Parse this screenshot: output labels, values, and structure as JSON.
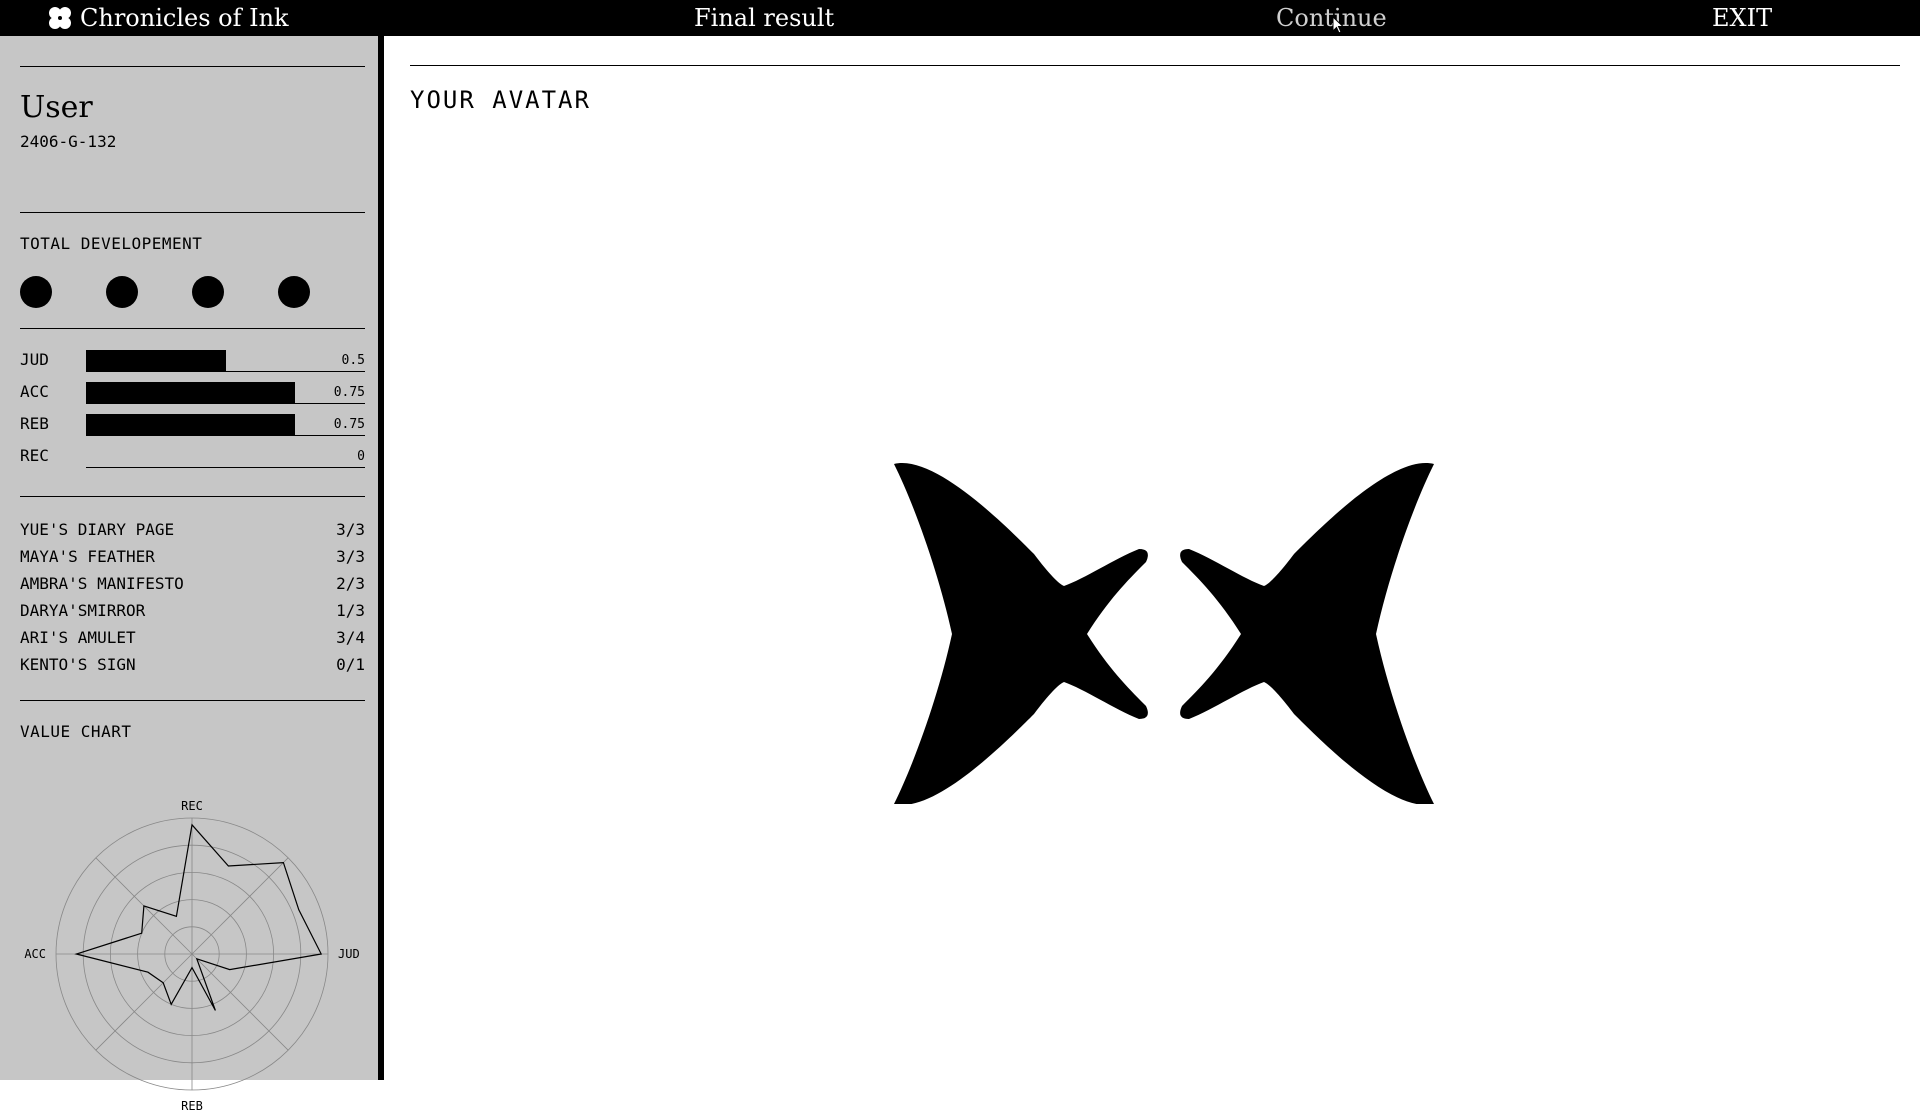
{
  "topbar": {
    "app_title": "Chronicles of Ink",
    "logo_icon": "four-petal-flower-icon",
    "final_result": "Final result",
    "continue": "Continue",
    "exit": "EXIT"
  },
  "user": {
    "name": "User",
    "id": "2406-G-132"
  },
  "development": {
    "title": "TOTAL DEVELOPEMENT",
    "dots_filled": 4
  },
  "stats": [
    {
      "label": "JUD",
      "value": 0.5,
      "display": "0.5"
    },
    {
      "label": "ACC",
      "value": 0.75,
      "display": "0.75"
    },
    {
      "label": "REB",
      "value": 0.75,
      "display": "0.75"
    },
    {
      "label": "REC",
      "value": 0,
      "display": "0"
    }
  ],
  "items": [
    {
      "name": "YUE'S DIARY PAGE",
      "count": "3/3"
    },
    {
      "name": "MAYA'S FEATHER",
      "count": "3/3"
    },
    {
      "name": "AMBRA'S MANIFESTO",
      "count": "2/3"
    },
    {
      "name": "DARYA'SMIRROR",
      "count": "1/3"
    },
    {
      "name": "ARI'S AMULET",
      "count": "3/4"
    },
    {
      "name": "KENTO'S SIGN",
      "count": "0/1"
    }
  ],
  "value_chart_title": "VALUE CHART",
  "chart_data": {
    "type": "radar",
    "axes": [
      "REC",
      "JUD",
      "REB",
      "ACC"
    ],
    "rlim": [
      0,
      1
    ],
    "grid": true,
    "series": [
      {
        "values": [
          0.95,
          0.7,
          0.95,
          0.85,
          0.95,
          0.3,
          0.05,
          0.45,
          0.1,
          0.4,
          0.3,
          0.35,
          0.85,
          0.4,
          0.5,
          0.3
        ]
      }
    ]
  },
  "main": {
    "title": "YOUR AVATAR"
  }
}
